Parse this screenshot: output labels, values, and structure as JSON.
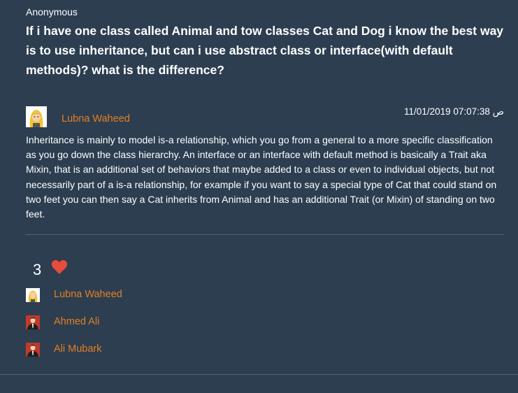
{
  "question": {
    "asker": "Anonymous",
    "text": "If i have one class called Animal and tow classes Cat and Dog i know the best way is to use inheritance, but can i use abstract class or interface(with default methods)? what is the difference?"
  },
  "answer": {
    "author": "Lubna Waheed",
    "timestamp": "11/01/2019 07:07:38 ص",
    "body": "Inheritance is mainly to model is-a relationship, which you go from a general to a more specific classification as you go down the class hierarchy. An interface or an interface with default method is basically a Trait aka Mixin, that is an additional set of behaviors that maybe added to a class or even to individual objects, but not necessarily part of a is-a relationship, for example if you want to say a special type of Cat that could stand on two feet you can then say a Cat inherits from Animal and has an additional Trait (or Mixin) of standing on two feet."
  },
  "likes": {
    "count": "3",
    "icon": "heart-icon",
    "icon_color": "#e74c3c",
    "users": [
      {
        "name": "Lubna Waheed",
        "avatar": "blonde-avatar-icon"
      },
      {
        "name": "Ahmed Ali",
        "avatar": "suit-avatar-icon"
      },
      {
        "name": "Ali Mubark",
        "avatar": "suit-avatar-icon"
      }
    ]
  },
  "colors": {
    "background": "#2c3e50",
    "link": "#e67e22",
    "divider": "#53667a"
  }
}
